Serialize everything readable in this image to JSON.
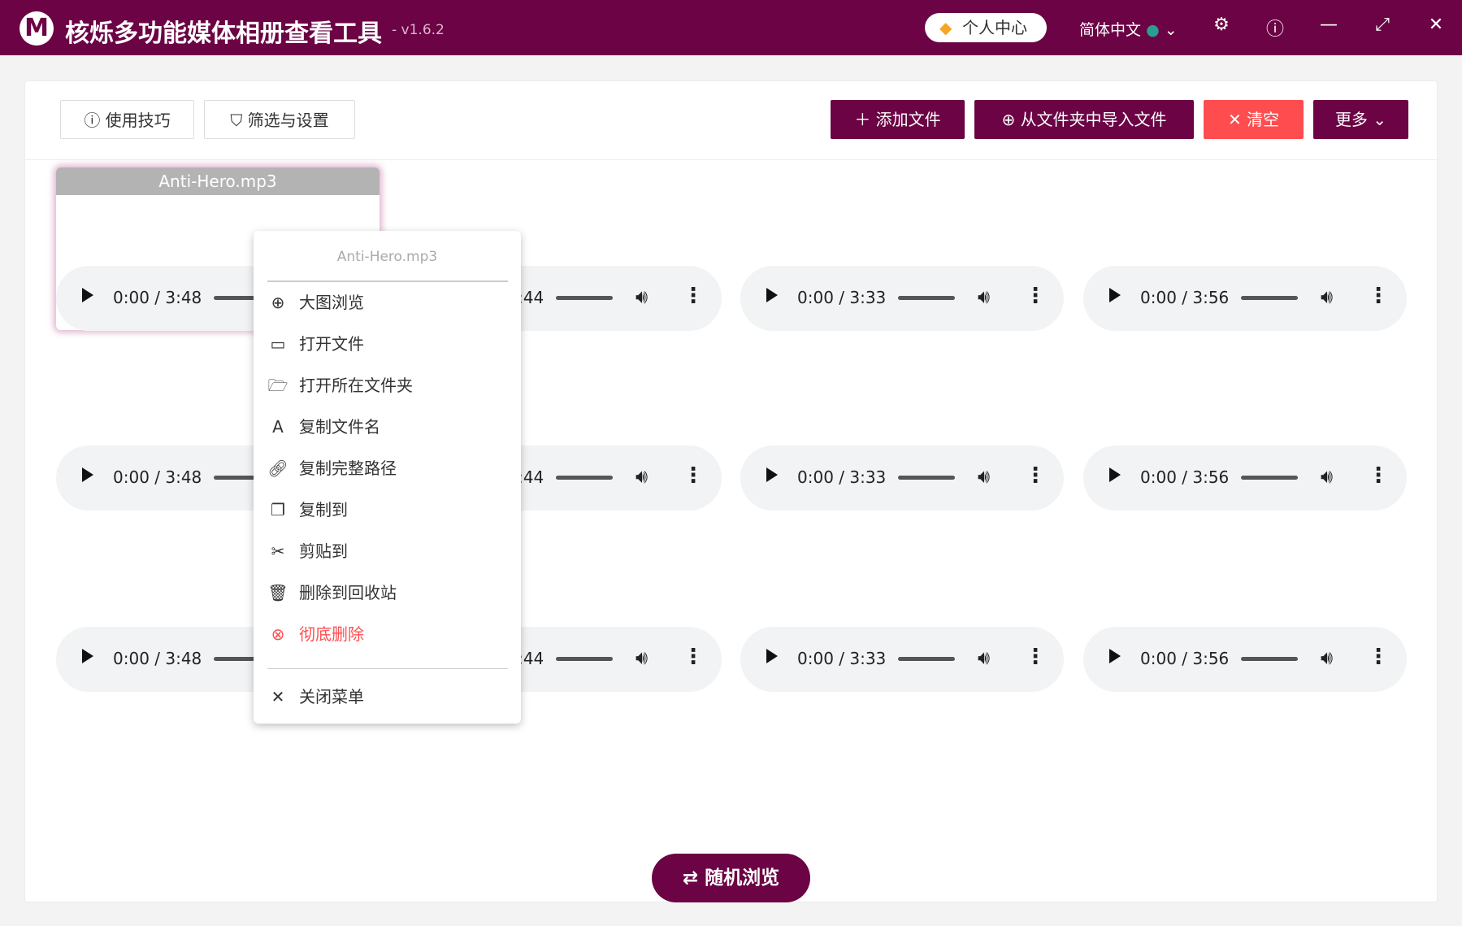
{
  "app": {
    "title": "核烁多功能媒体相册查看工具",
    "version": "- v1.6.2",
    "logo": "M",
    "user_center": "个人中心",
    "language": "简体中文"
  },
  "toolbar": {
    "tips": "使用技巧",
    "filter": "筛选与设置",
    "add_file": "添加文件",
    "import_folder": "从文件夹中导入文件",
    "clear": "清空",
    "more": "更多"
  },
  "selected_file": "Anti-Hero.mp3",
  "players": [
    [
      "0:00 / 3:48",
      "0:00 / 3:44",
      "0:00 / 3:33",
      "0:00 / 3:56"
    ],
    [
      "0:00 / 3:48",
      "0:00 / 3:44",
      "0:00 / 3:33",
      "0:00 / 3:56"
    ],
    [
      "0:00 / 3:48",
      "0:00 / 3:44",
      "0:00 / 3:33",
      "0:00 / 3:56"
    ]
  ],
  "menu": {
    "title": "Anti-Hero.mp3",
    "items": [
      "大图浏览",
      "打开文件",
      "打开所在文件夹",
      "复制文件名",
      "复制完整路径",
      "复制到",
      "剪贴到",
      "删除到回收站",
      "彻底删除"
    ],
    "close": "关闭菜单"
  },
  "random_browse": "随机浏览",
  "colors": {
    "brand": "#6b0344",
    "danger": "#ff4d4f"
  }
}
